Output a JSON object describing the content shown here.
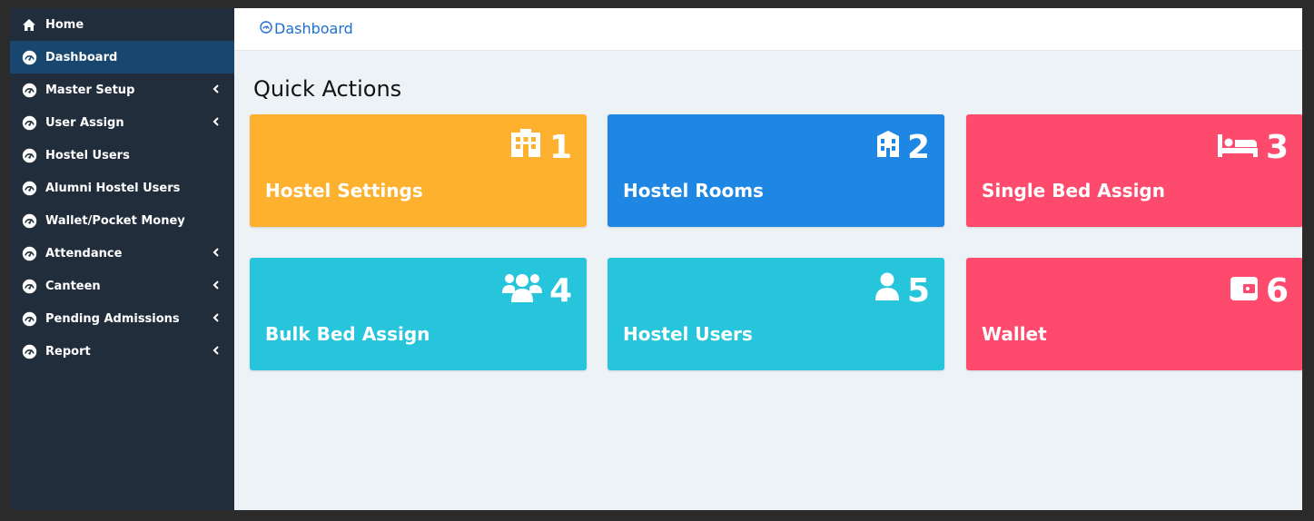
{
  "sidebar": {
    "items": [
      {
        "label": "Home",
        "icon": "home-icon",
        "has_submenu": false
      },
      {
        "label": "Dashboard",
        "icon": "dashboard-gauge-icon",
        "has_submenu": false,
        "active": true
      },
      {
        "label": "Master Setup",
        "icon": "dashboard-gauge-icon",
        "has_submenu": true
      },
      {
        "label": "User Assign",
        "icon": "dashboard-gauge-icon",
        "has_submenu": true
      },
      {
        "label": "Hostel Users",
        "icon": "dashboard-gauge-icon",
        "has_submenu": false
      },
      {
        "label": "Alumni Hostel Users",
        "icon": "dashboard-gauge-icon",
        "has_submenu": false
      },
      {
        "label": "Wallet/Pocket Money",
        "icon": "dashboard-gauge-icon",
        "has_submenu": false
      },
      {
        "label": "Attendance",
        "icon": "dashboard-gauge-icon",
        "has_submenu": true
      },
      {
        "label": "Canteen",
        "icon": "dashboard-gauge-icon",
        "has_submenu": true
      },
      {
        "label": "Pending Admissions",
        "icon": "dashboard-gauge-icon",
        "has_submenu": true
      },
      {
        "label": "Report",
        "icon": "dashboard-gauge-icon",
        "has_submenu": true
      }
    ]
  },
  "header": {
    "breadcrumb": "Dashboard"
  },
  "main": {
    "title": "Quick Actions",
    "cards": [
      {
        "label": "Hostel Settings",
        "number": "1",
        "icon": "building-icon",
        "color": "#fdb12e"
      },
      {
        "label": "Hostel Rooms",
        "number": "2",
        "icon": "hotel-icon",
        "color": "#1e87e3"
      },
      {
        "label": "Single Bed Assign",
        "number": "3",
        "icon": "bed-icon",
        "color": "#fe4a6d"
      },
      {
        "label": "Bulk Bed Assign",
        "number": "4",
        "icon": "users-icon",
        "color": "#26c5dc"
      },
      {
        "label": "Hostel Users",
        "number": "5",
        "icon": "user-icon",
        "color": "#26c5dc"
      },
      {
        "label": "Wallet",
        "number": "6",
        "icon": "wallet-icon",
        "color": "#fe4a6d"
      }
    ]
  },
  "colors": {
    "sidebar_bg": "#222d3c",
    "sidebar_active": "#17466e",
    "content_bg": "#edf2f6",
    "breadcrumb_link": "#1e6fd0"
  }
}
